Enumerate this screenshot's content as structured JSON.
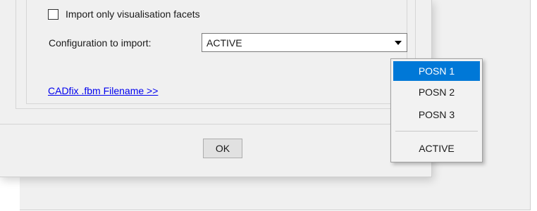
{
  "options": {
    "visualisation_facets_label": "Import only visualisation facets",
    "visualisation_facets_checked": false
  },
  "configuration": {
    "label": "Configuration to import:",
    "selected_value": "ACTIVE"
  },
  "link_text": "CADfix .fbm Filename >>",
  "ok_label": "OK",
  "dropdown": {
    "items": [
      "POSN 1",
      "POSN 2",
      "POSN 3",
      "ACTIVE"
    ],
    "highlighted": "POSN 1"
  },
  "colors": {
    "dialog_bg": "#f0f0f0",
    "highlight": "#0078d7",
    "link": "#0000ee"
  }
}
